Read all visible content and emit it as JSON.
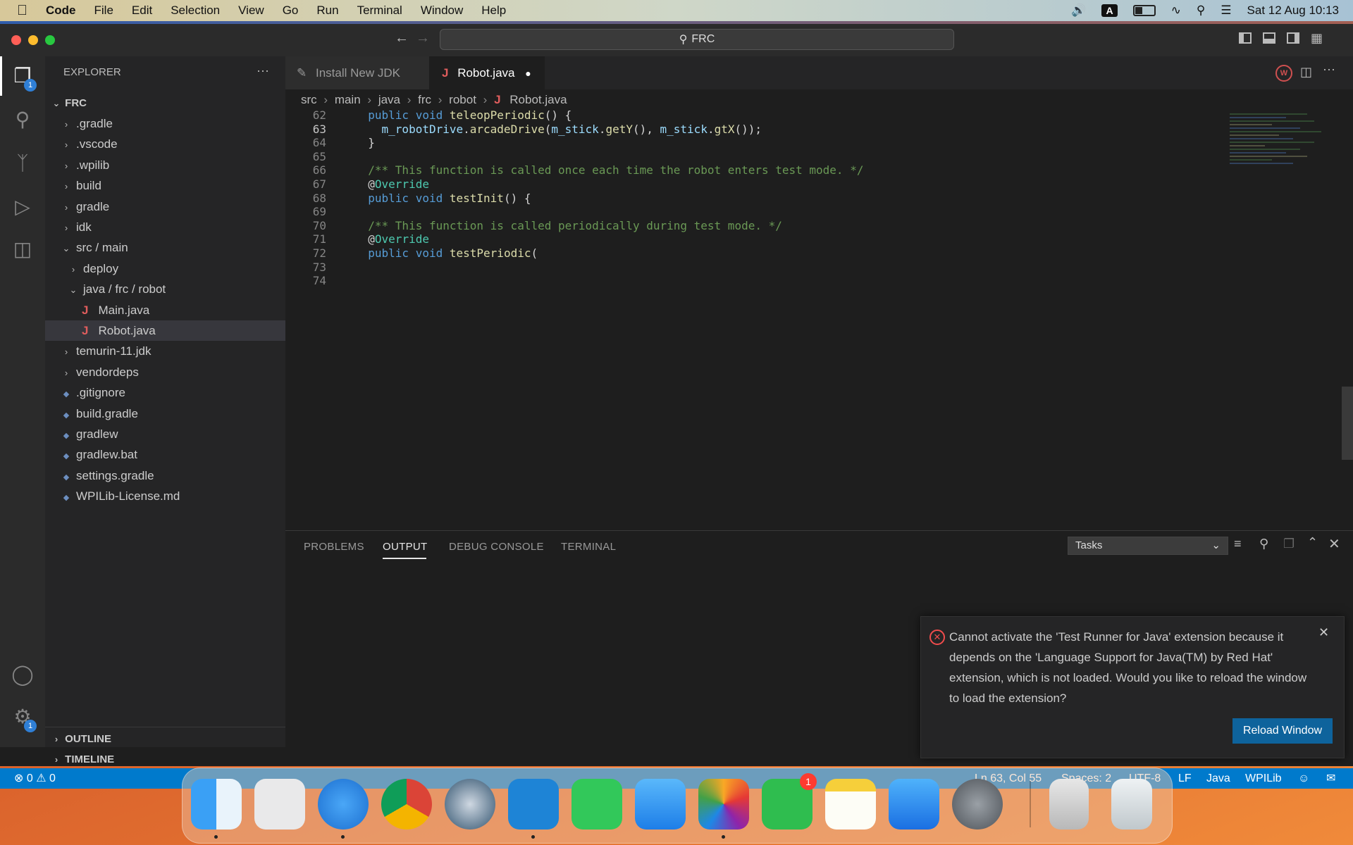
{
  "menubar": {
    "app": "Code",
    "items": [
      "File",
      "Edit",
      "Selection",
      "View",
      "Go",
      "Run",
      "Terminal",
      "Window",
      "Help"
    ],
    "input_indicator": "A",
    "datetime": "Sat 12 Aug  10:13"
  },
  "titlebar": {
    "search_text": "FRC"
  },
  "activitybar": {
    "explorer_badge": "1",
    "settings_badge": "1"
  },
  "sidebar": {
    "title": "EXPLORER",
    "more": "···",
    "root": "FRC",
    "tree": [
      {
        "label": ".gradle",
        "type": "folder"
      },
      {
        "label": ".vscode",
        "type": "folder"
      },
      {
        "label": ".wpilib",
        "type": "folder"
      },
      {
        "label": "build",
        "type": "folder"
      },
      {
        "label": "gradle",
        "type": "folder"
      },
      {
        "label": "idk",
        "type": "folder"
      },
      {
        "label": "src / main",
        "type": "open"
      },
      {
        "label": "deploy",
        "type": "folder"
      },
      {
        "label": "java / frc / robot",
        "type": "open"
      },
      {
        "label": "Main.java",
        "type": "java"
      },
      {
        "label": "Robot.java",
        "type": "java"
      },
      {
        "label": "temurin-11.jdk",
        "type": "folder"
      },
      {
        "label": "vendordeps",
        "type": "folder"
      },
      {
        "label": ".gitignore",
        "type": "file"
      },
      {
        "label": "build.gradle",
        "type": "file"
      },
      {
        "label": "gradlew",
        "type": "file"
      },
      {
        "label": "gradlew.bat",
        "type": "file"
      },
      {
        "label": "settings.gradle",
        "type": "file"
      },
      {
        "label": "WPILib-License.md",
        "type": "file"
      }
    ],
    "outline": "OUTLINE",
    "timeline": "TIMELINE"
  },
  "tabs": [
    {
      "label": "Install New JDK",
      "active": false
    },
    {
      "label": "Robot.java",
      "active": true,
      "modified_dot": "●"
    }
  ],
  "breadcrumb": [
    "src",
    "main",
    "java",
    "frc",
    "robot",
    "Robot.java"
  ],
  "code": {
    "lines": [
      {
        "n": "62",
        "text": "  public void teleopPeriodic() {"
      },
      {
        "n": "63",
        "text": "    m_robotDrive.arcadeDrive(m_stick.getY(), m_stick.gtX());"
      },
      {
        "n": "64",
        "text": "  }"
      },
      {
        "n": "65",
        "text": ""
      },
      {
        "n": "66",
        "text": "  /** This function is called once each time the robot enters test mode. */"
      },
      {
        "n": "67",
        "text": "  @Override"
      },
      {
        "n": "68",
        "text": "  public void testInit() {"
      },
      {
        "n": "69",
        "text": ""
      },
      {
        "n": "70",
        "text": "  /** This function is called periodically during test mode. */"
      },
      {
        "n": "71",
        "text": "  @Override"
      },
      {
        "n": "72",
        "text": "  public void testPeriodic("
      },
      {
        "n": "73",
        "text": ""
      },
      {
        "n": "74",
        "text": ""
      }
    ]
  },
  "panel": {
    "tabs": [
      "PROBLEMS",
      "OUTPUT",
      "DEBUG CONSOLE",
      "TERMINAL"
    ],
    "active_tab": "OUTPUT",
    "channel": "Tasks"
  },
  "notification": {
    "message": "Cannot activate the 'Test Runner for Java' extension because it depends on the 'Language Support for Java(TM) by Red Hat' extension, which is not loaded. Would you like to reload the window to load the extension?",
    "button": "Reload Window"
  },
  "statusbar": {
    "errors": "0",
    "warnings": "0",
    "position": "Ln 63, Col 55",
    "spaces": "Spaces: 2",
    "encoding": "UTF-8",
    "eol": "LF",
    "language": "Java",
    "wpilib": "WPILib"
  },
  "dock": {
    "facetime_badge": "1",
    "apps": [
      "Finder",
      "Launchpad",
      "Safari",
      "Chrome",
      "Instruments",
      "VS Code",
      "Messages",
      "Mail",
      "Photos",
      "FaceTime",
      "Notes",
      "App Store",
      "System Settings",
      "Archive",
      "Trash"
    ]
  }
}
